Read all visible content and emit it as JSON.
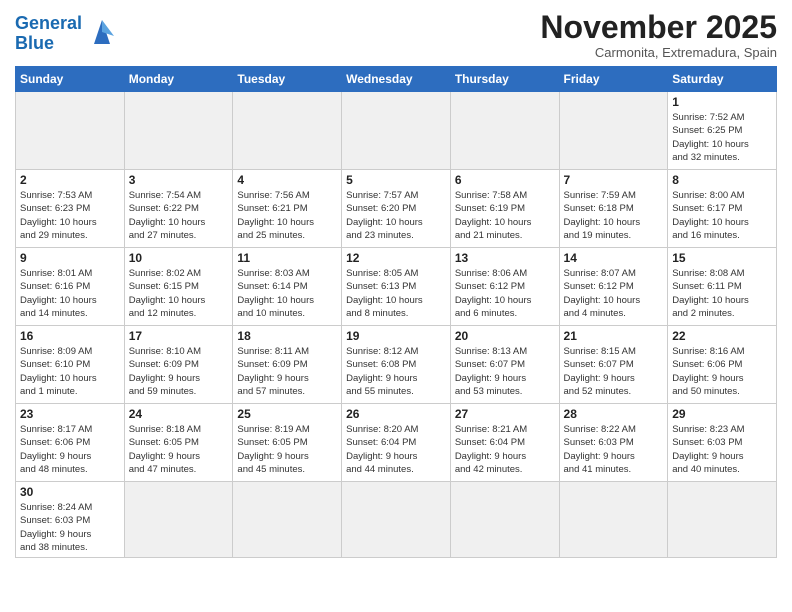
{
  "logo": {
    "text_general": "General",
    "text_blue": "Blue"
  },
  "header": {
    "month_year": "November 2025",
    "location": "Carmonita, Extremadura, Spain"
  },
  "weekdays": [
    "Sunday",
    "Monday",
    "Tuesday",
    "Wednesday",
    "Thursday",
    "Friday",
    "Saturday"
  ],
  "weeks": [
    [
      {
        "day": "",
        "empty": true
      },
      {
        "day": "",
        "empty": true
      },
      {
        "day": "",
        "empty": true
      },
      {
        "day": "",
        "empty": true
      },
      {
        "day": "",
        "empty": true
      },
      {
        "day": "",
        "empty": true
      },
      {
        "day": "1",
        "info": "Sunrise: 7:52 AM\nSunset: 6:25 PM\nDaylight: 10 hours\nand 32 minutes."
      }
    ],
    [
      {
        "day": "2",
        "info": "Sunrise: 7:53 AM\nSunset: 6:23 PM\nDaylight: 10 hours\nand 29 minutes."
      },
      {
        "day": "3",
        "info": "Sunrise: 7:54 AM\nSunset: 6:22 PM\nDaylight: 10 hours\nand 27 minutes."
      },
      {
        "day": "4",
        "info": "Sunrise: 7:56 AM\nSunset: 6:21 PM\nDaylight: 10 hours\nand 25 minutes."
      },
      {
        "day": "5",
        "info": "Sunrise: 7:57 AM\nSunset: 6:20 PM\nDaylight: 10 hours\nand 23 minutes."
      },
      {
        "day": "6",
        "info": "Sunrise: 7:58 AM\nSunset: 6:19 PM\nDaylight: 10 hours\nand 21 minutes."
      },
      {
        "day": "7",
        "info": "Sunrise: 7:59 AM\nSunset: 6:18 PM\nDaylight: 10 hours\nand 19 minutes."
      },
      {
        "day": "8",
        "info": "Sunrise: 8:00 AM\nSunset: 6:17 PM\nDaylight: 10 hours\nand 16 minutes."
      }
    ],
    [
      {
        "day": "9",
        "info": "Sunrise: 8:01 AM\nSunset: 6:16 PM\nDaylight: 10 hours\nand 14 minutes."
      },
      {
        "day": "10",
        "info": "Sunrise: 8:02 AM\nSunset: 6:15 PM\nDaylight: 10 hours\nand 12 minutes."
      },
      {
        "day": "11",
        "info": "Sunrise: 8:03 AM\nSunset: 6:14 PM\nDaylight: 10 hours\nand 10 minutes."
      },
      {
        "day": "12",
        "info": "Sunrise: 8:05 AM\nSunset: 6:13 PM\nDaylight: 10 hours\nand 8 minutes."
      },
      {
        "day": "13",
        "info": "Sunrise: 8:06 AM\nSunset: 6:12 PM\nDaylight: 10 hours\nand 6 minutes."
      },
      {
        "day": "14",
        "info": "Sunrise: 8:07 AM\nSunset: 6:12 PM\nDaylight: 10 hours\nand 4 minutes."
      },
      {
        "day": "15",
        "info": "Sunrise: 8:08 AM\nSunset: 6:11 PM\nDaylight: 10 hours\nand 2 minutes."
      }
    ],
    [
      {
        "day": "16",
        "info": "Sunrise: 8:09 AM\nSunset: 6:10 PM\nDaylight: 10 hours\nand 1 minute."
      },
      {
        "day": "17",
        "info": "Sunrise: 8:10 AM\nSunset: 6:09 PM\nDaylight: 9 hours\nand 59 minutes."
      },
      {
        "day": "18",
        "info": "Sunrise: 8:11 AM\nSunset: 6:09 PM\nDaylight: 9 hours\nand 57 minutes."
      },
      {
        "day": "19",
        "info": "Sunrise: 8:12 AM\nSunset: 6:08 PM\nDaylight: 9 hours\nand 55 minutes."
      },
      {
        "day": "20",
        "info": "Sunrise: 8:13 AM\nSunset: 6:07 PM\nDaylight: 9 hours\nand 53 minutes."
      },
      {
        "day": "21",
        "info": "Sunrise: 8:15 AM\nSunset: 6:07 PM\nDaylight: 9 hours\nand 52 minutes."
      },
      {
        "day": "22",
        "info": "Sunrise: 8:16 AM\nSunset: 6:06 PM\nDaylight: 9 hours\nand 50 minutes."
      }
    ],
    [
      {
        "day": "23",
        "info": "Sunrise: 8:17 AM\nSunset: 6:06 PM\nDaylight: 9 hours\nand 48 minutes."
      },
      {
        "day": "24",
        "info": "Sunrise: 8:18 AM\nSunset: 6:05 PM\nDaylight: 9 hours\nand 47 minutes."
      },
      {
        "day": "25",
        "info": "Sunrise: 8:19 AM\nSunset: 6:05 PM\nDaylight: 9 hours\nand 45 minutes."
      },
      {
        "day": "26",
        "info": "Sunrise: 8:20 AM\nSunset: 6:04 PM\nDaylight: 9 hours\nand 44 minutes."
      },
      {
        "day": "27",
        "info": "Sunrise: 8:21 AM\nSunset: 6:04 PM\nDaylight: 9 hours\nand 42 minutes."
      },
      {
        "day": "28",
        "info": "Sunrise: 8:22 AM\nSunset: 6:03 PM\nDaylight: 9 hours\nand 41 minutes."
      },
      {
        "day": "29",
        "info": "Sunrise: 8:23 AM\nSunset: 6:03 PM\nDaylight: 9 hours\nand 40 minutes."
      }
    ],
    [
      {
        "day": "30",
        "info": "Sunrise: 8:24 AM\nSunset: 6:03 PM\nDaylight: 9 hours\nand 38 minutes."
      },
      {
        "day": "",
        "empty": true
      },
      {
        "day": "",
        "empty": true
      },
      {
        "day": "",
        "empty": true
      },
      {
        "day": "",
        "empty": true
      },
      {
        "day": "",
        "empty": true
      },
      {
        "day": "",
        "empty": true
      }
    ]
  ]
}
